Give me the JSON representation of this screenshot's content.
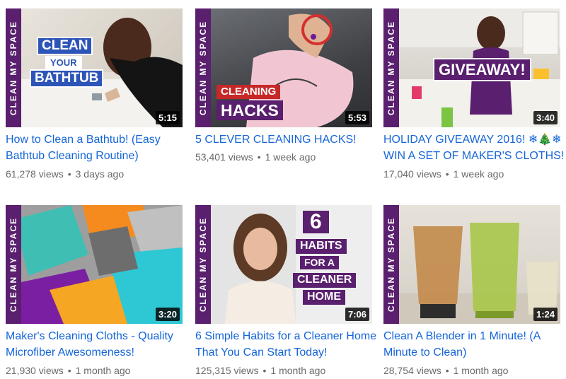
{
  "brand_band": "CLEAN MY SPACE",
  "videos": [
    {
      "title": "How to Clean a Bathtub! (Easy Bathtub Cleaning Routine)",
      "views": "61,278 views",
      "age": "3 days ago",
      "duration": "5:15",
      "overlay": [
        "CLEAN",
        "YOUR",
        "BATHTUB"
      ]
    },
    {
      "title": "5 CLEVER CLEANING HACKS!",
      "views": "53,401 views",
      "age": "1 week ago",
      "duration": "5:53",
      "overlay": [
        "CLEANING",
        "HACKS"
      ]
    },
    {
      "title": "HOLIDAY GIVEAWAY 2016! ❄🎄❄ WIN A SET OF MAKER'S CLOTHS!",
      "views": "17,040 views",
      "age": "1 week ago",
      "duration": "3:40",
      "overlay": [
        "GIVEAWAY!"
      ]
    },
    {
      "title": "Maker's Cleaning Cloths - Quality Microfiber Awesomeness!",
      "views": "21,930 views",
      "age": "1 month ago",
      "duration": "3:20",
      "overlay": []
    },
    {
      "title": "6 Simple Habits for a Cleaner Home That You Can Start Today!",
      "views": "125,315 views",
      "age": "1 month ago",
      "duration": "7:06",
      "overlay": [
        "6",
        "HABITS",
        "FOR A",
        "CLEANER",
        "HOME"
      ]
    },
    {
      "title": "Clean A Blender in 1 Minute! (A Minute to Clean)",
      "views": "28,754 views",
      "age": "1 month ago",
      "duration": "1:24",
      "overlay": []
    }
  ],
  "colors": {
    "title_link": "#1565d8",
    "meta_text": "#6a6a6a",
    "brand_purple": "#5a1f6e",
    "plate_blue": "#2d55b8",
    "plate_red": "#c62828"
  }
}
